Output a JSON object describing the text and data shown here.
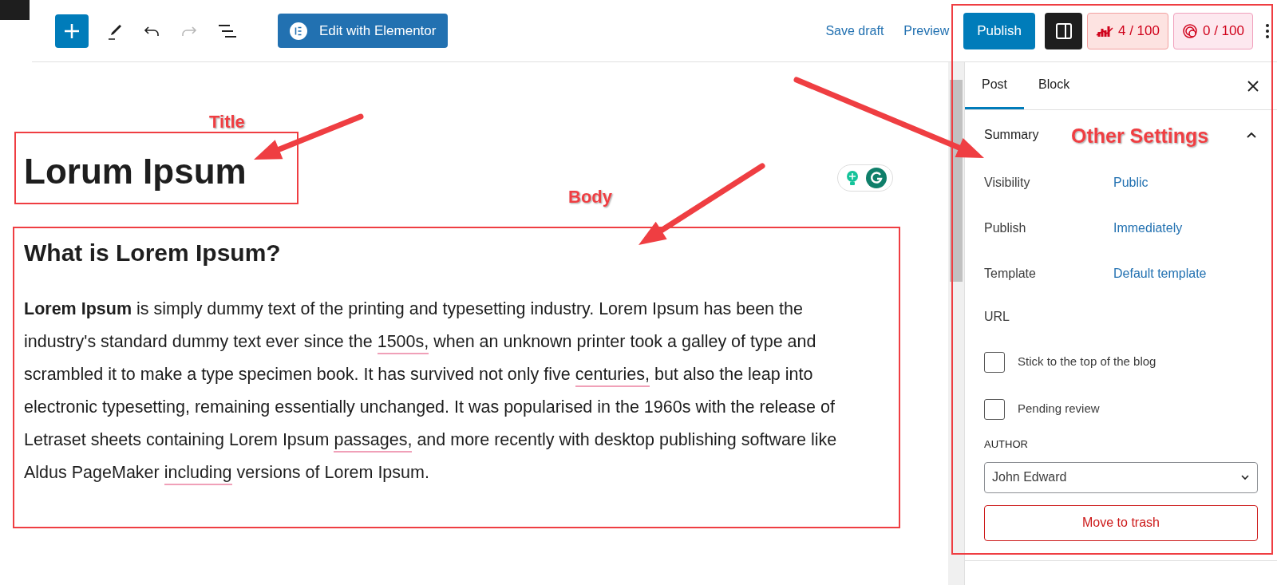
{
  "toolbar": {
    "edit_button": "Edit with Elementor",
    "save_draft": "Save draft",
    "preview": "Preview",
    "publish": "Publish",
    "scores": [
      "4 / 100",
      "0 / 100"
    ]
  },
  "editor": {
    "title": "Lorum Ipsum",
    "heading": "What is Lorem Ipsum?",
    "paragraph": [
      {
        "text": "**Lorem Ipsum** is simply dummy text of the printing and typesetting industry. Lorem Ipsum has been the industry's standard dummy text ever since the ",
        "flagged": false
      },
      {
        "text": "1500s,",
        "flagged": true
      },
      {
        "text": " when an unknown printer took a galley of type and scrambled it to make a type specimen book. It has survived not only five ",
        "flagged": false
      },
      {
        "text": "centuries,",
        "flagged": true
      },
      {
        "text": " but also the leap into electronic typesetting, remaining essentially unchanged. It was popularised in the 1960s with the release of Letraset sheets containing Lorem Ipsum ",
        "flagged": false
      },
      {
        "text": "passages,",
        "flagged": true
      },
      {
        "text": " and more recently with desktop publishing software like Aldus PageMaker ",
        "flagged": false
      },
      {
        "text": "including",
        "flagged": true
      },
      {
        "text": " versions of Lorem Ipsum.",
        "flagged": false
      }
    ]
  },
  "sidebar": {
    "tabs": [
      {
        "label": "Post",
        "selected": true
      },
      {
        "label": "Block",
        "selected": false
      }
    ],
    "section": {
      "title": "Summary",
      "expanded": true
    },
    "fields": [
      {
        "label": "Visibility",
        "value": "Public"
      },
      {
        "label": "Publish",
        "value": "Immediately"
      },
      {
        "label": "Template",
        "value": "Default template"
      },
      {
        "label": "URL"
      }
    ],
    "checkboxes": [
      {
        "label": "Stick to the top of the blog",
        "checked": false
      },
      {
        "label": "Pending review",
        "checked": false
      }
    ],
    "author": {
      "label": "AUTHOR",
      "value": "John Edward"
    },
    "trash_button": "Move to trash"
  },
  "annotations": [
    {
      "label": "Title"
    },
    {
      "label": "Body"
    },
    {
      "label": "Other Settings"
    }
  ]
}
